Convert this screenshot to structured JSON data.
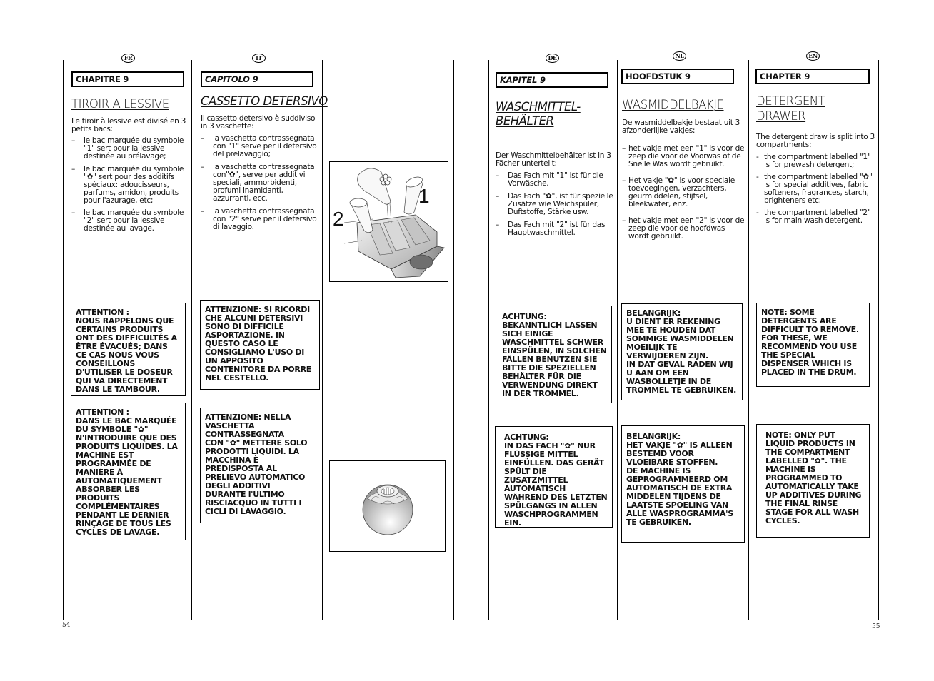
{
  "pages": {
    "left_number": "54",
    "right_number": "55"
  },
  "columns": {
    "fr": {
      "lang": "FR",
      "chapter": "CHAPITRE 9",
      "title": "TIROIR A LESSIVE",
      "intro": "Le tiroir à lessive est divisé en 3 petits bacs:",
      "items": [
        "le bac marquée du symbole \"1\" sert pour la lessive destinée au prélavage;",
        "le bac marquée du symbole \"✿\" sert pour des additifs spéciaux: adoucisseurs, parfums, amidon, produits pour l'azurage, etc;",
        "le bac marquée du symbole \"2\" sert pour la lessive destinée au lavage."
      ],
      "note1": "ATTENTION :\nNOUS RAPPELONS QUE CERTAINS PRODUITS ONT DES DIFFICULTÉS A ÊTRE  ÉVACUÉS; DANS CE CAS NOUS VOUS CONSEILLONS D'UTILISER LE DOSEUR QUI VA DIRECTEMENT DANS LE TAMBOUR.",
      "note2": "ATTENTION :\nDANS LE BAC MARQUÉE DU SYMBOLE \"✿\" N'INTRODUIRE QUE DES PRODUITS LIQUIDES. LA MACHINE EST PROGRAMMÉE DE MANIÈRE À AUTOMATIQUEMENT ABSORBER LES PRODUITS COMPLÉMENTAIRES PENDANT LE DERNIER RINÇAGE DE TOUS LES CYCLES DE LAVAGE."
    },
    "it": {
      "lang": "IT",
      "chapter": "CAPITOLO 9",
      "title": "CASSETTO DETERSIVO",
      "intro": "Il cassetto detersivo è suddiviso in 3 vaschette:",
      "items": [
        "la vaschetta contrassegnata con \"1\" serve per il detersivo del prelavaggio;",
        "la vaschetta contrassegnata con\"✿\", serve per additivi speciali, ammorbidenti, profumi inamidanti, azzurranti, ecc.",
        "la vaschetta contrassegnata con \"2\" serve per il detersivo di lavaggio."
      ],
      "note1": "ATTENZIONE: SI RICORDI CHE ALCUNI DETERSIVI SONO DI DIFFICILE ASPORTAZIONE. IN QUESTO CASO LE CONSIGLIAMO L'USO DI UN APPOSITO CONTENITORE DA PORRE NEL CESTELLO.",
      "note2": "ATTENZIONE: NELLA VASCHETTA CONTRASSEGNATA\nCON \"✿\" METTERE SOLO PRODOTTI LIQUIDI. LA MACCHINA È PREDISPOSTA AL PRELIEVO AUTOMATICO DEGLI ADDITIVI DURANTE l'ULTIMO RISCIACQUO IN TUTTI I CICLI DI LAVAGGIO."
    },
    "de": {
      "lang": "DE",
      "chapter": "KAPITEL 9",
      "title_line1": "WASCHMITTEL-",
      "title_line2": "BEHÄLTER",
      "intro": "Der Waschmittelbehälter ist in 3 Fächer unterteilt:",
      "items": [
        "Das Fach mit \"1\" ist für die Vorwäsche.",
        "Das Fach \"✿\", ist für spezielle Zusätze wie Weichspüler, Duftstoffe, Stärke usw.",
        "Das Fach mit \"2\" ist für das Hauptwaschmittel."
      ],
      "note1": "ACHTUNG:\nBEKANNTLICH LASSEN SICH EINIGE WASCHMITTEL SCHWER EINSPÜLEN, IN SOLCHEN FÄLLEN BENUTZEN SIE BITTE DIE SPEZIELLEN BEHÄLTER FÜR DIE VERWENDUNG DIREKT IN DER TROMMEL.",
      "note2": "ACHTUNG:\nIN DAS FACH \"✿\" NUR FLÜSSIGE MITTEL EINFÜLLEN. DAS GERÄT SPÜLT DIE ZUSATZMITTEL AUTOMATISCH WÄHREND DES LETZTEN SPÜLGANGS IN ALLEN WASCHPROGRAMMEN EIN."
    },
    "nl": {
      "lang": "NL",
      "chapter": "HOOFDSTUK 9",
      "title": "WASMIDDELBAKJE",
      "intro": "De wasmiddelbakje bestaat uit 3 afzonderlijke vakjes:",
      "items": [
        "het vakje met een \"1\" is voor de zeep die voor de Voorwas of de Snelle Was wordt gebruikt.",
        "Het vakje \"✿\" is voor speciale toevoegingen, verzachters, geurmiddelen, stijfsel, bleekwater, enz.",
        "het vakje met een \"2\" is voor de zeep die voor de hoofdwas wordt gebruikt."
      ],
      "note1": "BELANGRIJK:\n U DIENT ER REKENING MEE TE HOUDEN DAT SOMMIGE WASMIDDELEN MOEILIJK TE VERWIJDEREN ZIJN.\nIN DAT GEVAL RADEN WIJ U AAN OM EEN WASBOLLETJE IN DE TROMMEL TE GEBRUIKEN.",
      "note2": "BELANGRIJK:\nHET VAKJE  \"✿\"  IS ALLEEN BESTEMD VOOR VLOEIBARE STOFFEN.\nDE MACHINE IS GEPROGRAMMEERD OM AUTOMATISCH DE EXTRA MIDDELEN TIJDENS DE LAATSTE SPOELING VAN ALLE WASPROGRAMMA'S TE GEBRUIKEN."
    },
    "en": {
      "lang": "EN",
      "chapter": "CHAPTER 9",
      "title_line1": "DETERGENT",
      "title_line2": "DRAWER",
      "intro": "The detergent draw is split into 3 compartments:",
      "items": [
        "the compartment labelled \"1\" is for prewash detergent;",
        "the compartment labelled \"✿\" is for special additives, fabric softeners, fragrances, starch, brighteners etc;",
        "the compartment labelled \"2\" is for main wash detergent."
      ],
      "note1": "NOTE: SOME DETERGENTS ARE DIFFICULT TO REMOVE. FOR THESE, WE RECOMMEND YOU USE THE SPECIAL DISPENSER WHICH IS PLACED IN THE DRUM.",
      "note2": "NOTE: ONLY PUT LIQUID PRODUCTS IN THE COMPARTMENT LABELLED \"✿\". THE MACHINE IS PROGRAMMED TO AUTOMATICALLY TAKE UP ADDITIVES DURING THE FINAL RINSE STAGE FOR ALL WASH CYCLES."
    }
  },
  "figures": {
    "drawer": {
      "label_1": "1",
      "label_2": "2",
      "icon": "flower-symbol"
    },
    "ball": {
      "icon": "dosing-ball"
    }
  },
  "dash": "–",
  "dash_short": "-"
}
